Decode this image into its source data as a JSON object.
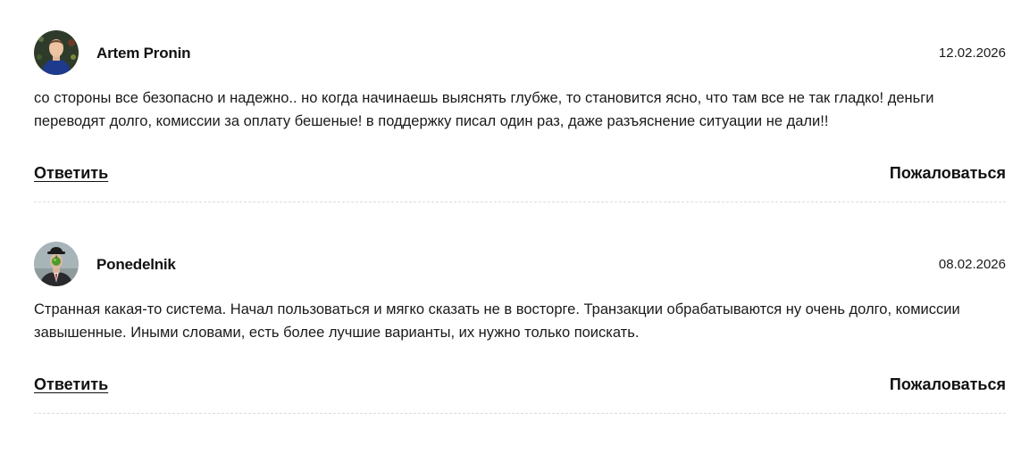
{
  "comments": [
    {
      "author": "Artem Pronin",
      "date": "12.02.2026",
      "text": "со стороны все безопасно и надежно.. но когда начинаешь выяснять глубже, то становится ясно, что там все не так гладко! деньги переводят долго, комиссии за оплату бешеные! в поддержку писал один раз, даже разъяснение ситуации не дали!!",
      "reply_label": "Ответить",
      "report_label": "Пожаловаться",
      "avatar_icon": "user-photo-icon"
    },
    {
      "author": "Ponedelnik",
      "date": "08.02.2026",
      "text": "Странная какая-то система. Начал пользоваться и мягко сказать не в восторге. Транзакции обрабатываются ну очень долго, комиссии завышенные. Иными словами, есть более лучшие варианты, их нужно только поискать.",
      "reply_label": "Ответить",
      "report_label": "Пожаловаться",
      "avatar_icon": "bowler-hat-man-icon"
    }
  ],
  "colors": {
    "text": "#1a1a1a",
    "divider": "#dcdcdc"
  }
}
